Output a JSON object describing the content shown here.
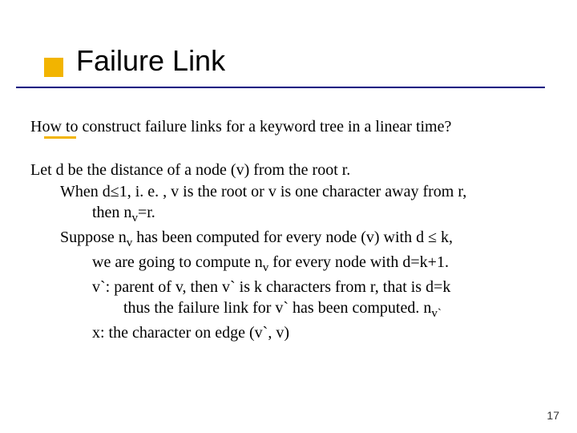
{
  "title": "Failure Link",
  "question": "How to construct failure links for a keyword tree in a linear time?",
  "lines": {
    "l1": "Let d be the distance of a node (v) from the root r.",
    "l2a": "When d≤1, i. e. , v is the root or v is one character away from r,",
    "l2b_pre": "then n",
    "l2b_sub": "v",
    "l2b_post": "=r.",
    "l3a_pre": "Suppose n",
    "l3a_sub": "v",
    "l3a_post": " has been computed for every node (v) with d ≤ k,",
    "l3b_pre": "we are going to compute n",
    "l3b_sub": "v",
    "l3b_post": " for every node with d=k+1.",
    "l3c": "v`: parent of v, then v` is k characters from r, that is d=k",
    "l3d_pre": "thus the failure link for v` has been computed. n",
    "l3d_sub": "v`",
    "l3e": "x: the character on edge (v`, v)"
  },
  "page": "17"
}
